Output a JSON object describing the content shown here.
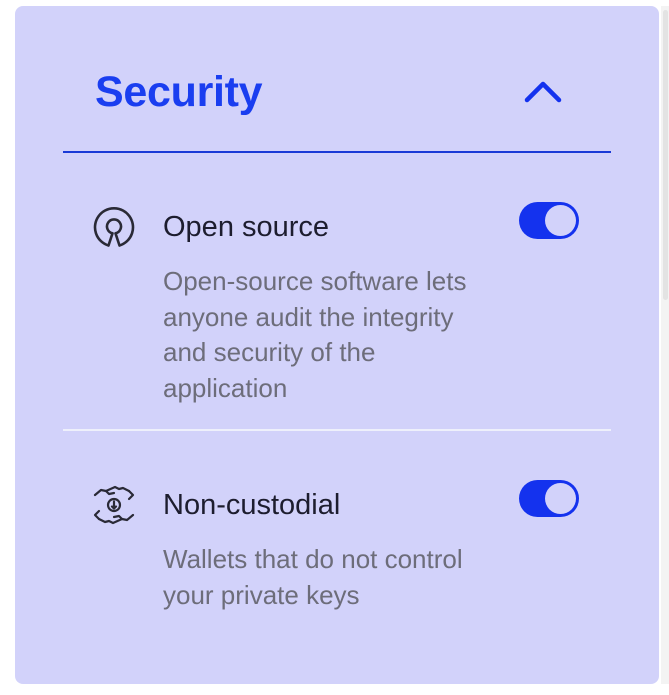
{
  "section": {
    "title": "Security",
    "expanded": true
  },
  "features": [
    {
      "icon": "open-source-icon",
      "name": "Open source",
      "description": "Open-source software lets anyone audit the integrity and security of the application",
      "enabled": true
    },
    {
      "icon": "hands-coin-icon",
      "name": "Non-custodial",
      "description": "Wallets that do not control your private keys",
      "enabled": true
    }
  ],
  "colors": {
    "panel_background": "#d2d2fa",
    "accent": "#1432ee",
    "title": "#1a3ef0",
    "text": "#1d1d2e",
    "muted_text": "#6d6d7a"
  }
}
